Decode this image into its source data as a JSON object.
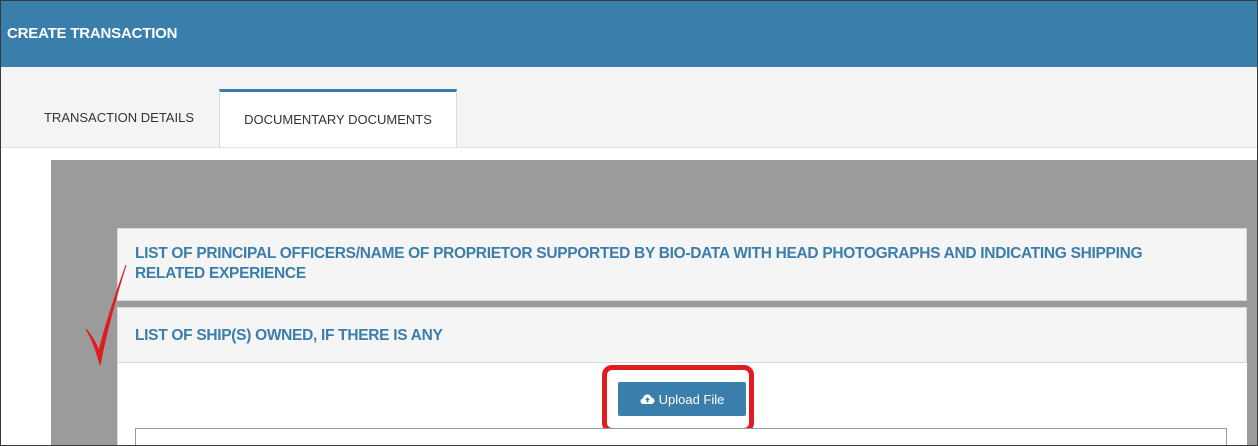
{
  "header": {
    "title": "CREATE TRANSACTION"
  },
  "tabs": [
    {
      "label": "TRANSACTION DETAILS",
      "active": false
    },
    {
      "label": "DOCUMENTARY DOCUMENTS",
      "active": true
    }
  ],
  "sections": [
    {
      "title": "LIST OF PRINCIPAL OFFICERS/NAME OF PROPRIETOR SUPPORTED BY BIO-DATA WITH HEAD PHOTOGRAPHS AND INDICATING SHIPPING RELATED EXPERIENCE"
    },
    {
      "title": "LIST OF SHIP(S) OWNED, IF THERE IS ANY"
    }
  ],
  "upload": {
    "label": "Upload File",
    "icon": "cloud-upload-icon"
  },
  "colors": {
    "primary": "#3a7eab",
    "annotation_red": "#e11b22",
    "backdrop_gray": "#9b9b9b"
  }
}
